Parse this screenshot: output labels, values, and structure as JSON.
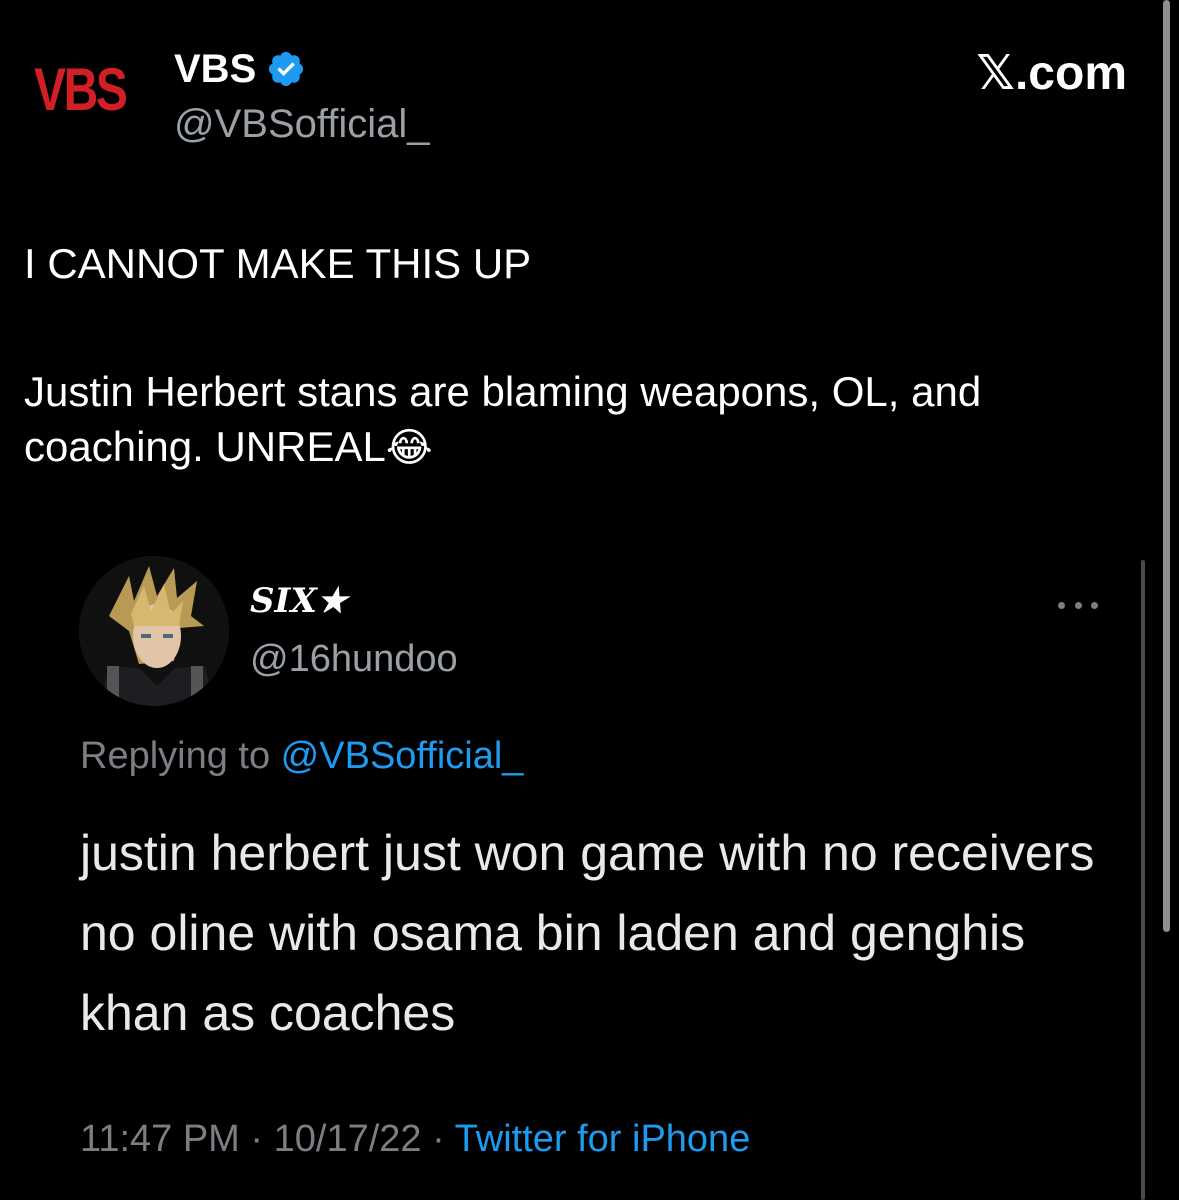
{
  "header": {
    "logo_text": "VBS",
    "display_name": "VBS",
    "handle": "@VBSofficial_",
    "site_label": "𝕏.com",
    "verified_icon": "verified-badge-icon",
    "verified_color": "#1d9bf0",
    "logo_color": "#d11f25"
  },
  "tweet": {
    "line1": "I CANNOT MAKE THIS UP",
    "line2": "Justin Herbert stans are blaming weapons, OL, and coaching. UNREAL",
    "emoji": "😂"
  },
  "quoted": {
    "display_name": "SIX★",
    "handle": "@16hundoo",
    "replying_prefix": "Replying to ",
    "replying_handle": "@VBSofficial_",
    "text": "justin herbert just won game with no receivers no oline with osama bin laden and genghis khan as coaches",
    "time": "11:47 PM",
    "date": "10/17/22",
    "separator": " · ",
    "source": "Twitter for iPhone",
    "link_color": "#1d9bf0"
  }
}
